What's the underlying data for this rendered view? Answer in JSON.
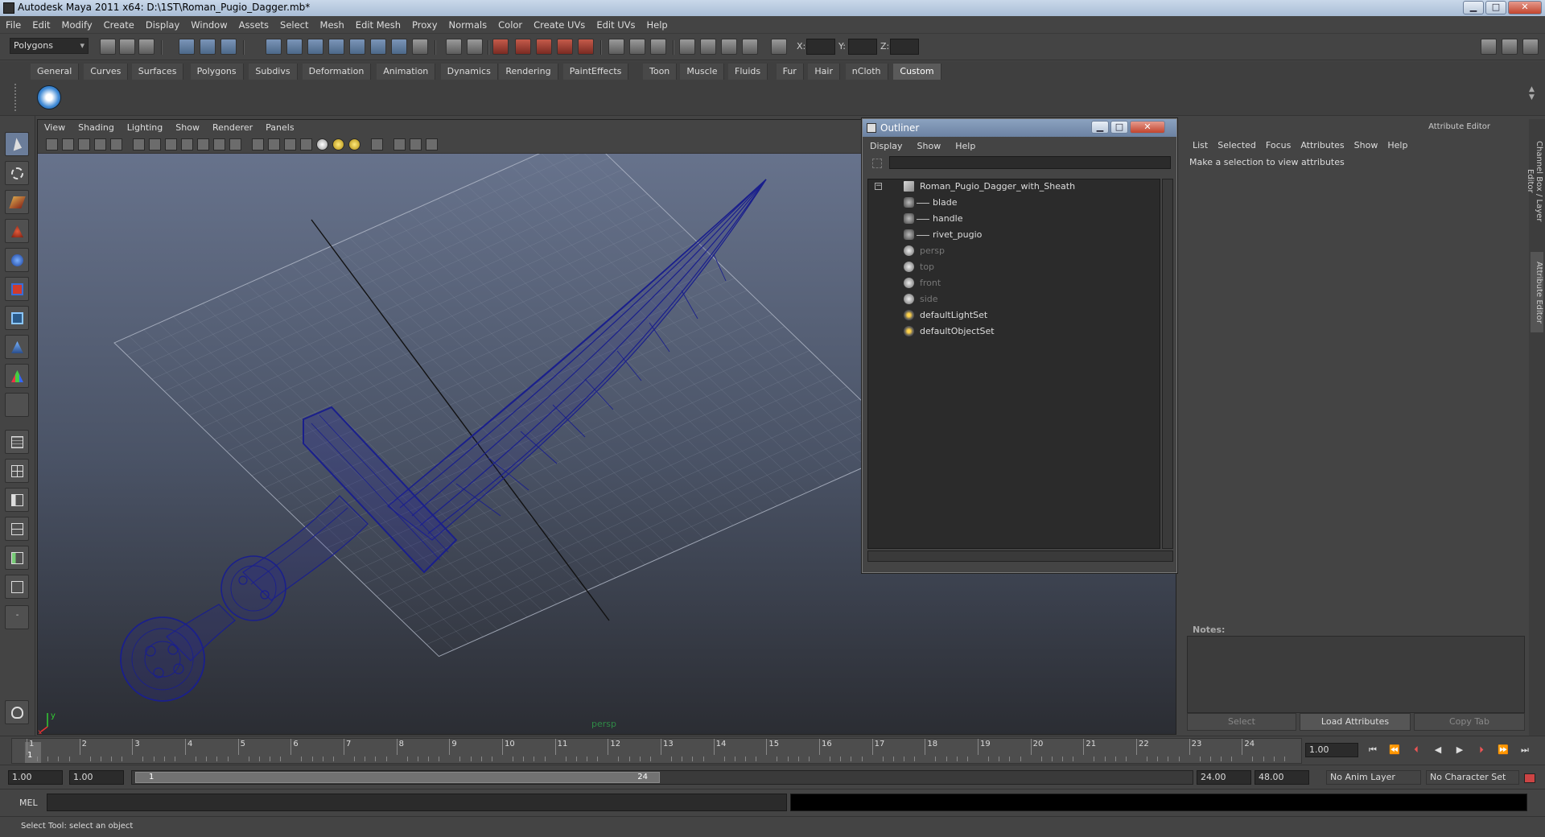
{
  "window": {
    "title": "Autodesk Maya 2011 x64: D:\\1ST\\Roman_Pugio_Dagger.mb*",
    "min": "▁",
    "max": "□",
    "close": "✕"
  },
  "menu": [
    "File",
    "Edit",
    "Modify",
    "Create",
    "Display",
    "Window",
    "Assets",
    "Select",
    "Mesh",
    "Edit Mesh",
    "Proxy",
    "Normals",
    "Color",
    "Create UVs",
    "Edit UVs",
    "Help"
  ],
  "toolbar": {
    "mode": "Polygons",
    "x_label": "X:",
    "y_label": "Y:",
    "z_label": "Z:"
  },
  "shelf": {
    "tabs": [
      "General",
      "Curves",
      "Surfaces",
      "Polygons",
      "Subdivs",
      "Deformation",
      "Animation",
      "Dynamics",
      "Rendering",
      "PaintEffects",
      "Toon",
      "Muscle",
      "Fluids",
      "Fur",
      "Hair",
      "nCloth",
      "Custom"
    ],
    "active": "Custom",
    "icon": "check-shelf-icon"
  },
  "viewport": {
    "menu": [
      "View",
      "Shading",
      "Lighting",
      "Show",
      "Renderer",
      "Panels"
    ],
    "camera": "persp",
    "axis_x": "x",
    "axis_y": "y",
    "wire_color": "#1a1f8c"
  },
  "outliner": {
    "title": "Outliner",
    "menu": [
      "Display",
      "Show",
      "Help"
    ],
    "items": [
      {
        "label": "Roman_Pugio_Dagger_with_Sheath",
        "indent": 0,
        "icon": "group-icon",
        "dim": false
      },
      {
        "label": "blade",
        "indent": 1,
        "icon": "mesh-icon",
        "dim": false
      },
      {
        "label": "handle",
        "indent": 1,
        "icon": "mesh-icon",
        "dim": false
      },
      {
        "label": "rivet_pugio",
        "indent": 1,
        "icon": "mesh-icon",
        "dim": false
      },
      {
        "label": "persp",
        "indent": 0,
        "icon": "camera-icon",
        "dim": true
      },
      {
        "label": "top",
        "indent": 0,
        "icon": "camera-icon",
        "dim": true
      },
      {
        "label": "front",
        "indent": 0,
        "icon": "camera-icon",
        "dim": true
      },
      {
        "label": "side",
        "indent": 0,
        "icon": "camera-icon",
        "dim": true
      },
      {
        "label": "defaultLightSet",
        "indent": 0,
        "icon": "set-icon",
        "dim": false
      },
      {
        "label": "defaultObjectSet",
        "indent": 0,
        "icon": "set-icon",
        "dim": false
      }
    ]
  },
  "attribute_editor": {
    "header": "Attribute Editor",
    "menu": [
      "List",
      "Selected",
      "Focus",
      "Attributes",
      "Show",
      "Help"
    ],
    "message": "Make a selection to view attributes",
    "notes_label": "Notes:",
    "buttons": {
      "select": "Select",
      "load": "Load Attributes",
      "copy": "Copy Tab"
    }
  },
  "side_tabs": {
    "channel_box": "Channel Box / Layer Editor",
    "attribute_editor": "Attribute Editor"
  },
  "timeline": {
    "frames": [
      "1",
      "2",
      "3",
      "4",
      "5",
      "6",
      "7",
      "8",
      "9",
      "10",
      "11",
      "12",
      "13",
      "14",
      "15",
      "16",
      "17",
      "18",
      "19",
      "20",
      "21",
      "22",
      "23",
      "24"
    ],
    "current": "1",
    "current_field": "1.00"
  },
  "range": {
    "start": "1.00",
    "start2": "1.00",
    "bar_start": "1",
    "bar_end": "24",
    "end": "24.00",
    "end2": "48.00",
    "anim_layer": "No Anim Layer",
    "char_set": "No Character Set"
  },
  "command": {
    "label": "MEL"
  },
  "help_line": "Select Tool: select an object"
}
